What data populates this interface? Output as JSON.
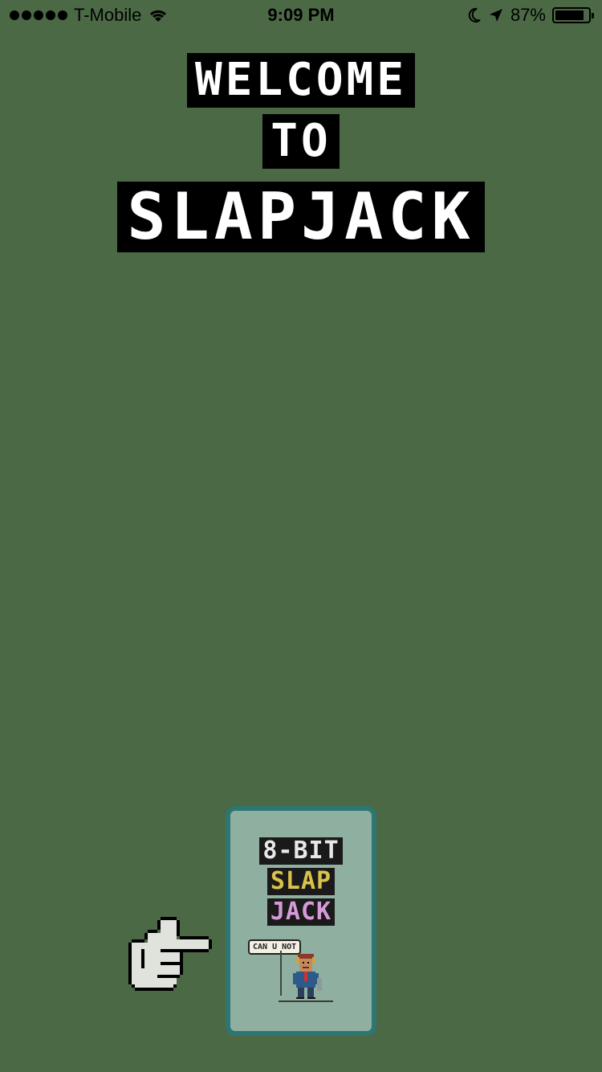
{
  "status_bar": {
    "carrier": "T-Mobile",
    "time": "9:09 PM",
    "battery_percent": "87%",
    "battery_level": 0.87,
    "icons": [
      "signal-dots-icon",
      "wifi-icon",
      "moon-icon",
      "location-arrow-icon",
      "battery-icon"
    ]
  },
  "title": {
    "line1": "WELCOME",
    "line2": "TO",
    "line3": "SLAPJACK"
  },
  "card": {
    "line1": "8-BIT",
    "line2": "SLAP",
    "line3": "JACK",
    "speech": "CAN U NOT"
  },
  "colors": {
    "background": "#4b6945",
    "card_border": "#2d7672",
    "card_face": "#8fb0a0"
  }
}
